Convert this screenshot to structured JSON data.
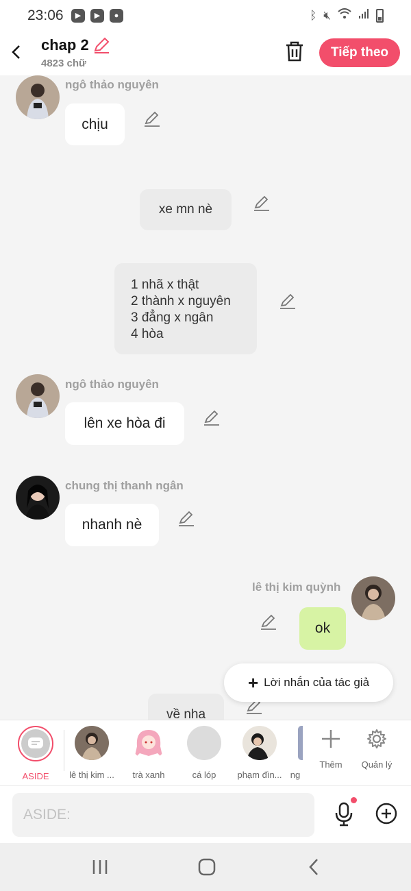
{
  "status_bar": {
    "time": "23:06",
    "apps": [
      "youtube-icon",
      "youtube-icon",
      "camera-icon"
    ],
    "icons": [
      "bluetooth-icon",
      "mute-icon",
      "wifi-icon",
      "signal-icon",
      "battery-icon"
    ]
  },
  "header": {
    "title": "chap 2",
    "word_count": "4823 chữ",
    "next_label": "Tiếp theo"
  },
  "messages": [
    {
      "sender": "ngô thảo nguyên",
      "text": "chịu"
    },
    {
      "sender": "",
      "text": "xe mn nè"
    },
    {
      "sender": "",
      "lines": [
        "1 nhã x thật",
        "2 thành x nguyên",
        "3 đẳng x ngân",
        "4 hòa"
      ]
    },
    {
      "sender": "ngô thảo nguyên",
      "text": "lên xe hòa đi"
    },
    {
      "sender": "chung thị thanh ngân",
      "text": "nhanh nè"
    },
    {
      "sender": "lê thị kim quỳnh",
      "text": "ok"
    },
    {
      "sender": "",
      "text": "về nha"
    }
  ],
  "author_note": "Lời nhắn của tác giả",
  "characters": [
    {
      "label": "ASIDE"
    },
    {
      "label": "lê thị kim ..."
    },
    {
      "label": "trà xanh"
    },
    {
      "label": "cá lóp"
    },
    {
      "label": "phạm đìn..."
    },
    {
      "label": "ng"
    }
  ],
  "tools": {
    "add_label": "Thêm",
    "manage_label": "Quản lý"
  },
  "input": {
    "placeholder": "ASIDE:"
  },
  "colors": {
    "accent": "#f24e6b",
    "my_bubble": "#d7f3a4",
    "aside_bubble": "#ebebeb"
  }
}
